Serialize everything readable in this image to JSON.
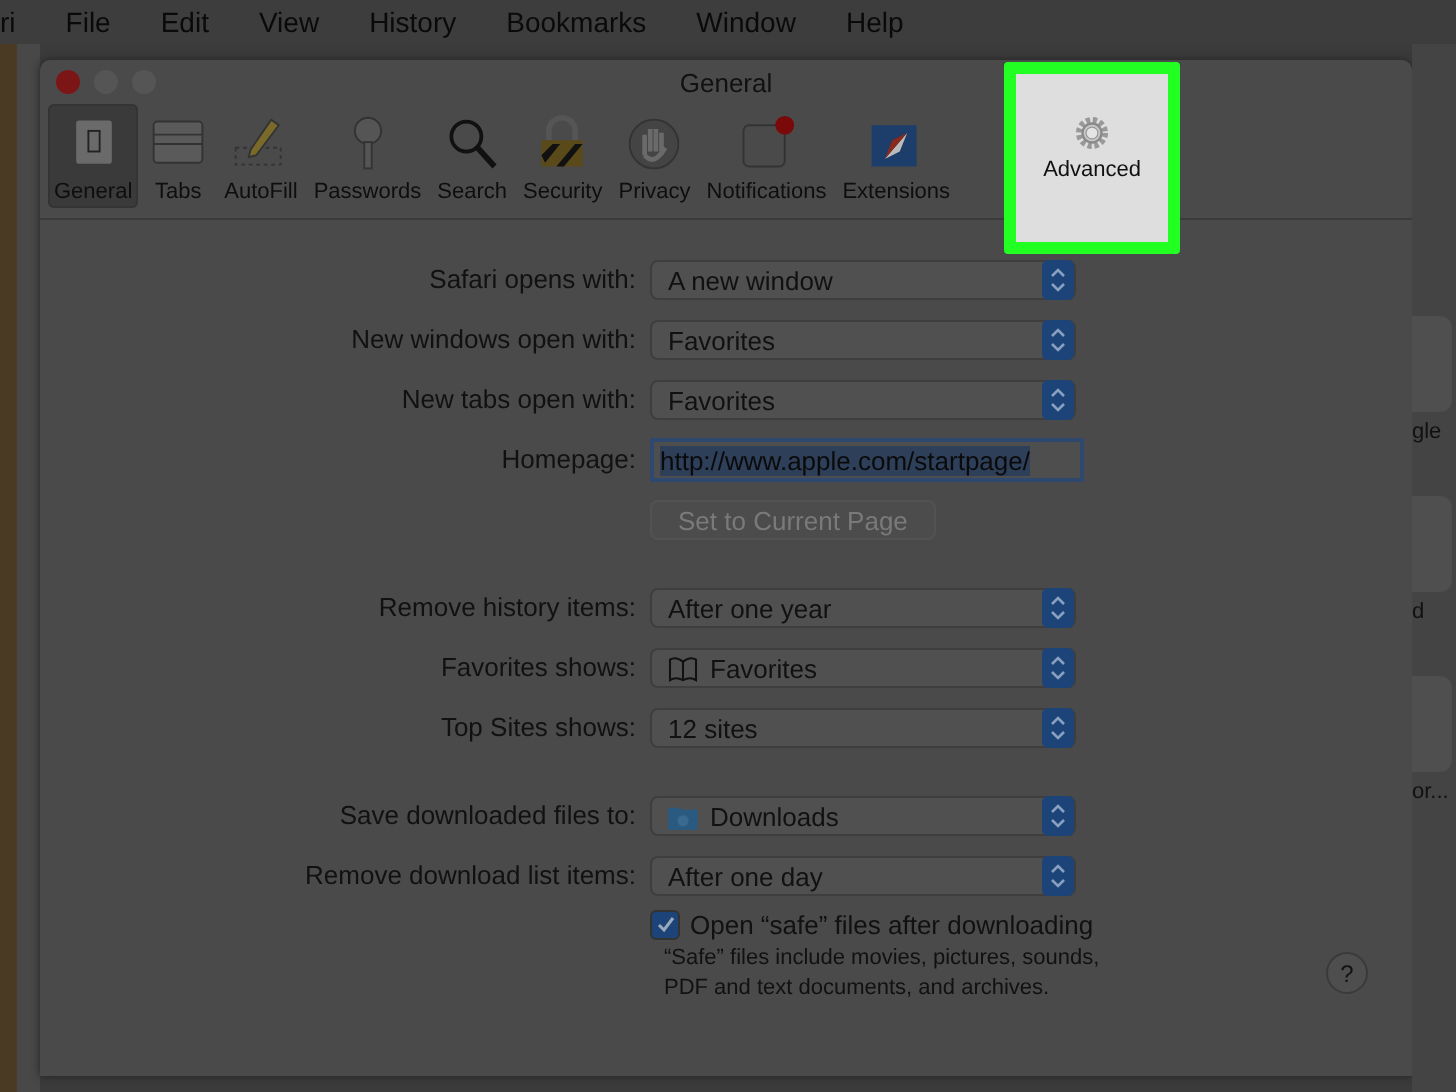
{
  "menu_bar": {
    "items": [
      "ri",
      "File",
      "Edit",
      "View",
      "History",
      "Bookmarks",
      "Window",
      "Help"
    ]
  },
  "background_window": {
    "texts": [
      "gle",
      "d",
      "or..."
    ]
  },
  "window": {
    "title": "General"
  },
  "tabs": [
    {
      "label": "General",
      "selected": true,
      "highlighted": false
    },
    {
      "label": "Tabs",
      "selected": false,
      "highlighted": false
    },
    {
      "label": "AutoFill",
      "selected": false,
      "highlighted": false
    },
    {
      "label": "Passwords",
      "selected": false,
      "highlighted": false
    },
    {
      "label": "Search",
      "selected": false,
      "highlighted": false
    },
    {
      "label": "Security",
      "selected": false,
      "highlighted": false
    },
    {
      "label": "Privacy",
      "selected": false,
      "highlighted": false
    },
    {
      "label": "Notifications",
      "selected": false,
      "highlighted": false
    },
    {
      "label": "Extensions",
      "selected": false,
      "highlighted": false
    },
    {
      "label": "Advanced",
      "selected": false,
      "highlighted": true
    }
  ],
  "sections": [
    {
      "rows": [
        {
          "kind": "popup",
          "label": "Safari opens with:",
          "value": "A new window"
        },
        {
          "kind": "popup",
          "label": "New windows open with:",
          "value": "Favorites"
        },
        {
          "kind": "popup",
          "label": "New tabs open with:",
          "value": "Favorites"
        },
        {
          "kind": "text",
          "label": "Homepage:",
          "value": "http://www.apple.com/startpage/"
        },
        {
          "kind": "button",
          "label": "Set to Current Page",
          "disabled": true
        }
      ]
    },
    {
      "rows": [
        {
          "kind": "popup",
          "label": "Remove history items:",
          "value": "After one year"
        },
        {
          "kind": "bookmark-popup",
          "label": "Favorites shows:",
          "value": "Favorites"
        },
        {
          "kind": "popup",
          "label": "Top Sites shows:",
          "value": "12 sites"
        }
      ]
    },
    {
      "rows": [
        {
          "kind": "folder-popup",
          "label": "Save downloaded files to:",
          "value": "Downloads"
        },
        {
          "kind": "popup",
          "label": "Remove download list items:",
          "value": "After one day"
        },
        {
          "kind": "checkbox",
          "label": "Open “safe” files after downloading",
          "checked": true
        },
        {
          "kind": "note",
          "label": "“Safe” files include movies, pictures, sounds, PDF and text documents, and archives."
        }
      ]
    }
  ],
  "help_button": {
    "label": "?"
  }
}
